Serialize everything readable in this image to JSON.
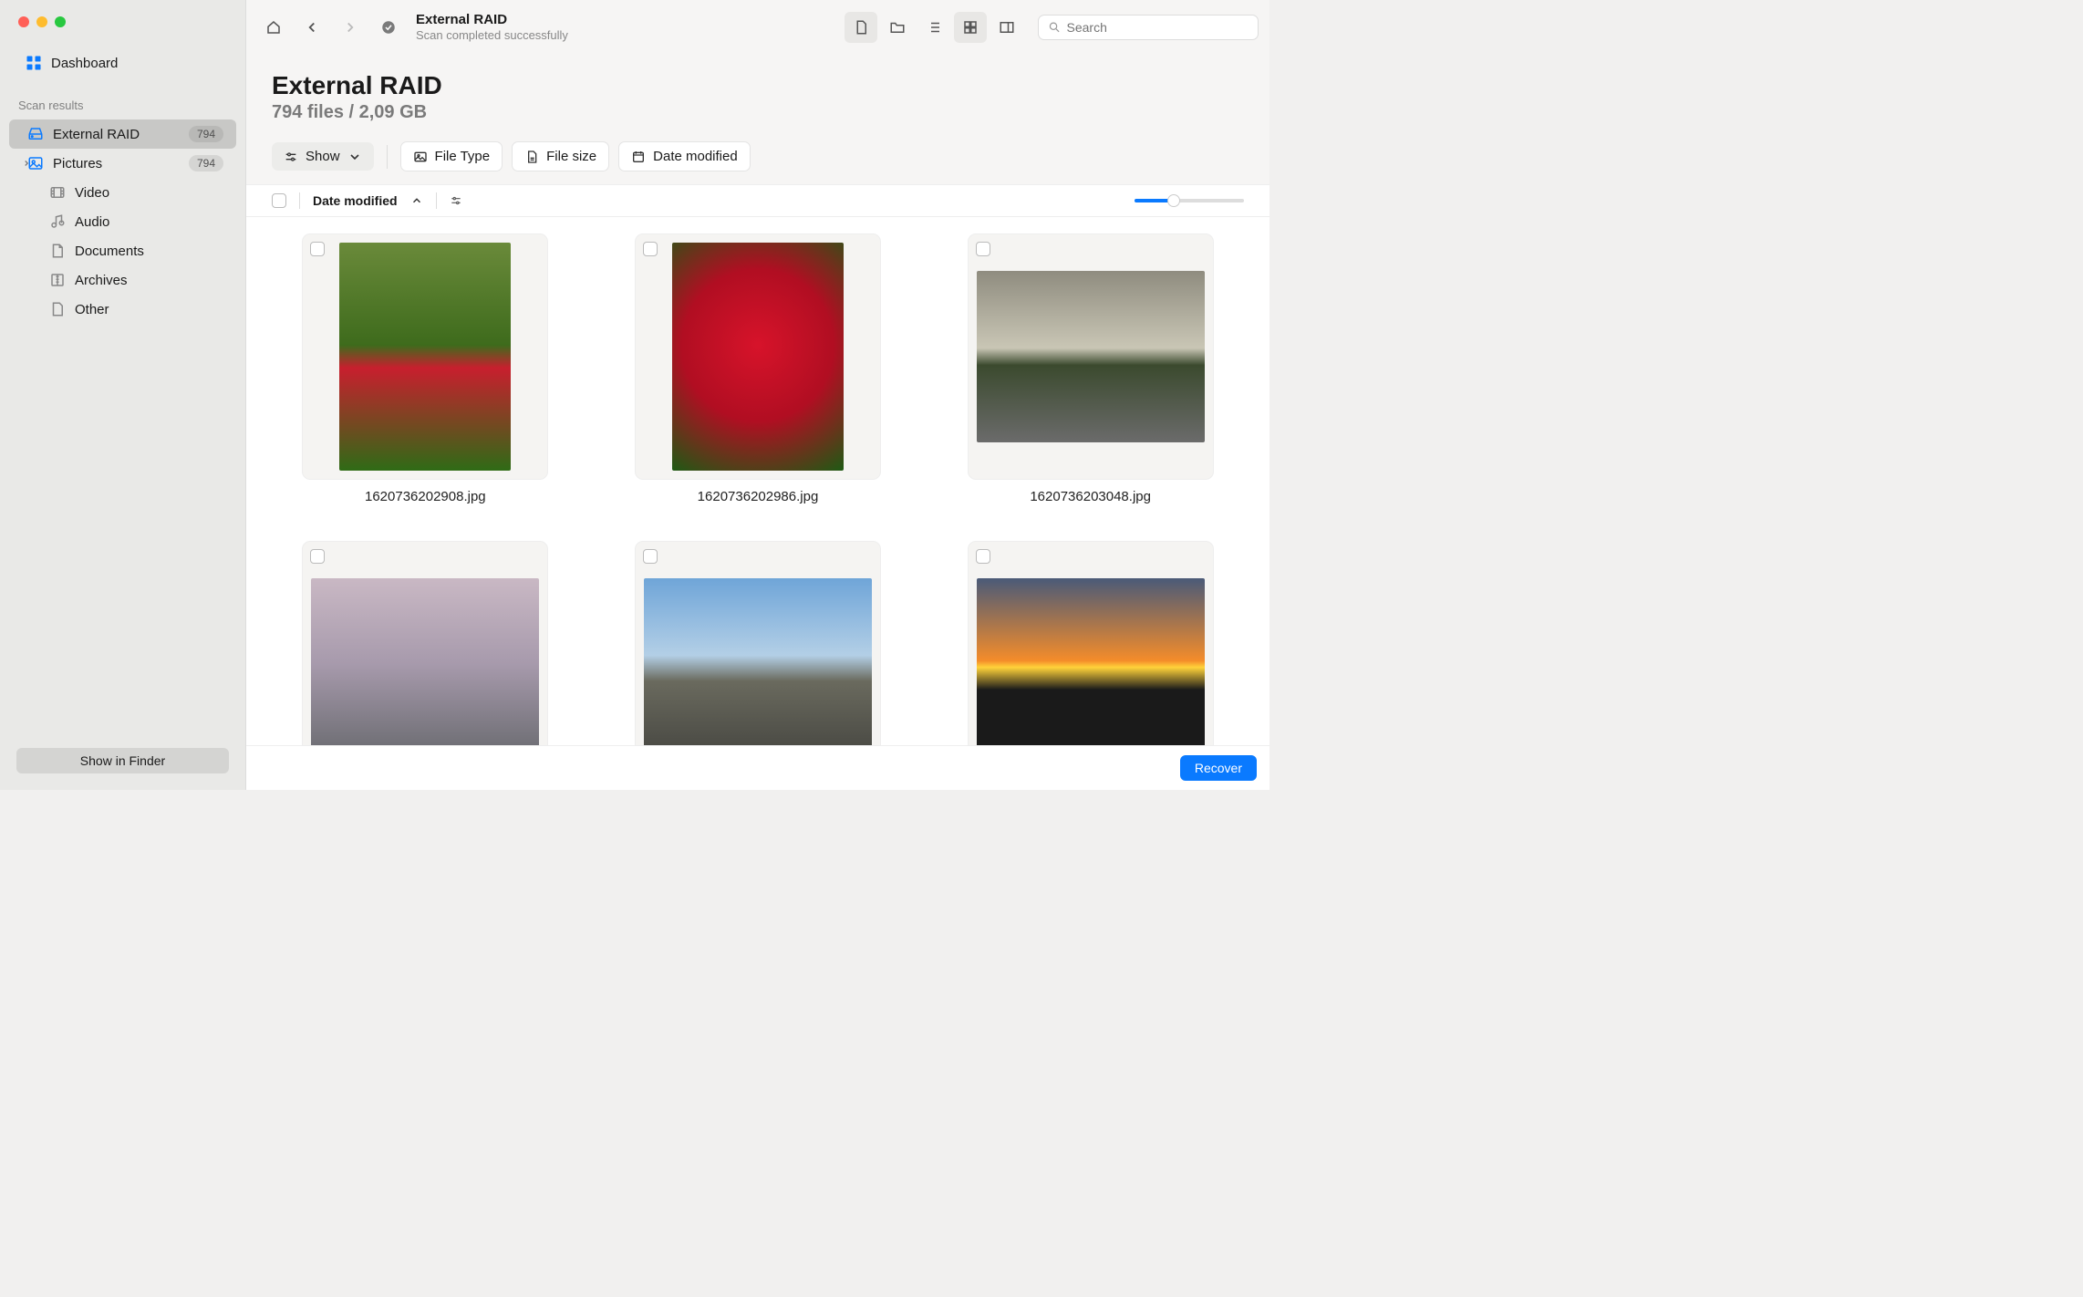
{
  "sidebar": {
    "dashboard": "Dashboard",
    "section_title": "Scan results",
    "items": [
      {
        "label": "External RAID",
        "badge": "794",
        "selected": true,
        "icon": "drive"
      },
      {
        "label": "Pictures",
        "badge": "794",
        "expandable": true,
        "icon": "picture"
      },
      {
        "label": "Video",
        "icon": "video"
      },
      {
        "label": "Audio",
        "icon": "audio"
      },
      {
        "label": "Documents",
        "icon": "document"
      },
      {
        "label": "Archives",
        "icon": "archive"
      },
      {
        "label": "Other",
        "icon": "other"
      }
    ],
    "show_in_finder": "Show in Finder"
  },
  "topbar": {
    "title": "External RAID",
    "subtitle": "Scan completed successfully",
    "search_placeholder": "Search"
  },
  "header": {
    "title": "External RAID",
    "stats": "794 files / 2,09 GB"
  },
  "filters": {
    "show": "Show",
    "file_type": "File Type",
    "file_size": "File size",
    "date_modified": "Date modified"
  },
  "sortbar": {
    "label": "Date modified"
  },
  "files": [
    {
      "name": "1620736202908.jpg",
      "orient": "portrait",
      "bg": "ph1"
    },
    {
      "name": "1620736202986.jpg",
      "orient": "portrait",
      "bg": "ph2"
    },
    {
      "name": "1620736203048.jpg",
      "orient": "land",
      "bg": "ph3"
    },
    {
      "name": "",
      "orient": "land",
      "bg": "ph4"
    },
    {
      "name": "",
      "orient": "land",
      "bg": "ph5"
    },
    {
      "name": "",
      "orient": "land",
      "bg": "ph6"
    }
  ],
  "footer": {
    "recover": "Recover"
  }
}
